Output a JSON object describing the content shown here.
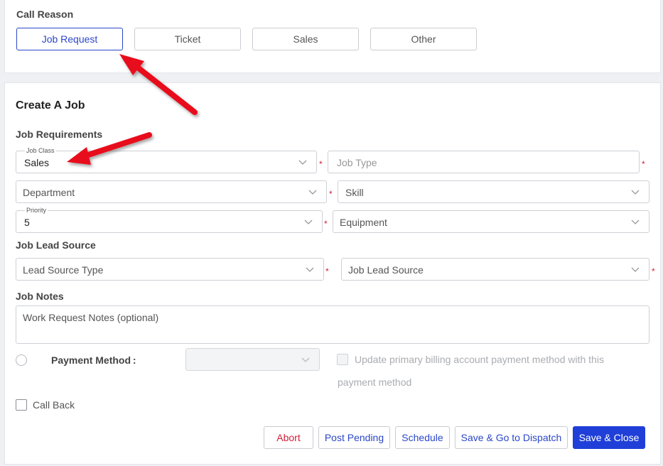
{
  "call_reason": {
    "heading": "Call Reason",
    "options": [
      "Job Request",
      "Ticket",
      "Sales",
      "Other"
    ],
    "selected": "Job Request"
  },
  "create_job": {
    "title": "Create A Job",
    "requirements_heading": "Job Requirements",
    "job_class": {
      "label": "Job Class",
      "value": "Sales"
    },
    "job_type": {
      "placeholder": "Job Type"
    },
    "department": {
      "placeholder": "Department"
    },
    "skill": {
      "placeholder": "Skill"
    },
    "priority": {
      "label": "Priority",
      "value": "5"
    },
    "equipment": {
      "placeholder": "Equipment"
    },
    "lead_source_heading": "Job Lead Source",
    "lead_source_type": {
      "placeholder": "Lead Source Type"
    },
    "job_lead_source": {
      "placeholder": "Job Lead Source"
    },
    "notes_heading": "Job Notes",
    "notes": {
      "placeholder": "Work Request Notes (optional)"
    },
    "payment_method_label": "Payment Method :",
    "update_billing_text": "Update primary billing account payment method with this payment method",
    "call_back_label": "Call Back",
    "required_mark": "*"
  },
  "actions": {
    "abort": "Abort",
    "post_pending": "Post Pending",
    "schedule": "Schedule",
    "save_dispatch": "Save & Go to Dispatch",
    "save_close": "Save & Close"
  },
  "colors": {
    "accent": "#2b47c9",
    "primary_button": "#1f3fd8",
    "required": "#d0203a",
    "annotation_arrow": "#e8101a"
  }
}
